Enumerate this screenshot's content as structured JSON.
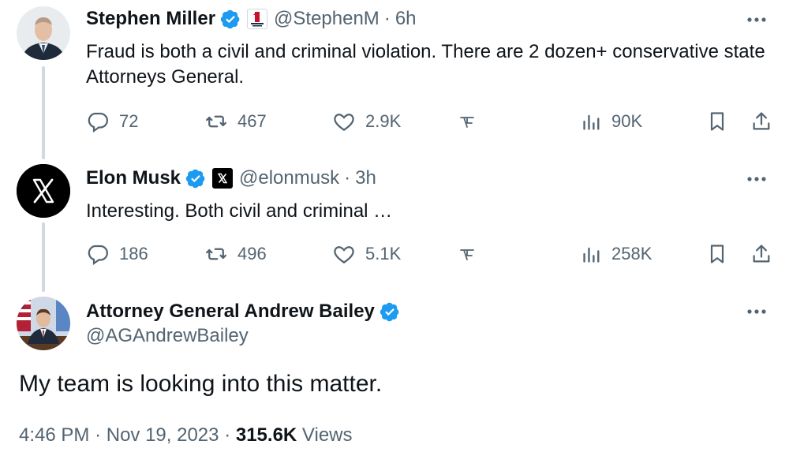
{
  "tweets": [
    {
      "name": "Stephen Miller",
      "handle": "@StephenM",
      "separator": "·",
      "time": "6h",
      "text": "Fraud is both a civil and criminal violation. There are 2 dozen+ conservative state Attorneys General.",
      "replies": "72",
      "retweets": "467",
      "likes": "2.9K",
      "views": "90K"
    },
    {
      "name": "Elon Musk",
      "handle": "@elonmusk",
      "separator": "·",
      "time": "3h",
      "text": "Interesting. Both civil and criminal …",
      "replies": "186",
      "retweets": "496",
      "likes": "5.1K",
      "views": "258K"
    }
  ],
  "main_tweet": {
    "name": "Attorney General Andrew Bailey",
    "handle": "@AGAndrewBailey",
    "text": "My team is looking into this matter.",
    "time": "4:46 PM",
    "separator": "·",
    "date": "Nov 19, 2023",
    "separator2": "·",
    "views_count": "315.6K",
    "views_label": "Views"
  },
  "colors": {
    "verified": "#1d9bf0",
    "secondary_text": "#536471",
    "primary_text": "#0f1419",
    "thread_line": "#cfd9de"
  },
  "icons": [
    "more-icon",
    "verified-badge-icon",
    "reply-icon",
    "retweet-icon",
    "like-icon",
    "grok-icon",
    "views-icon",
    "bookmark-icon",
    "share-icon"
  ]
}
